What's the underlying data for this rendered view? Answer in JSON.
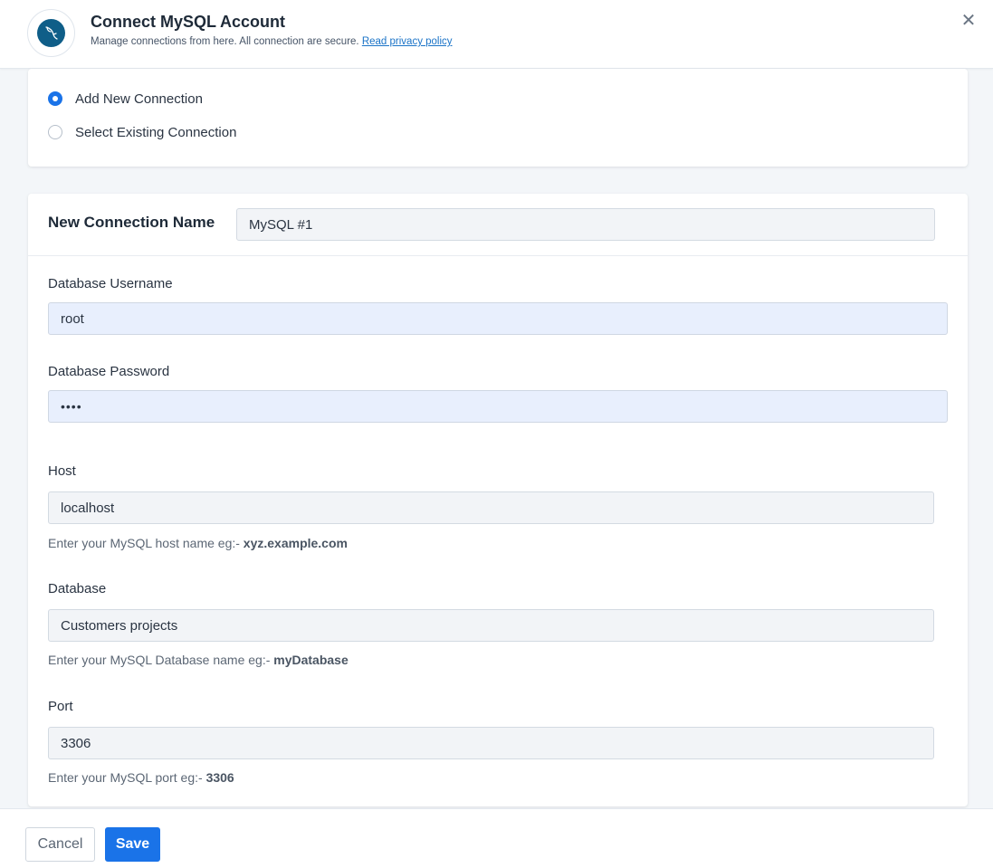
{
  "header": {
    "title": "Connect MySQL Account",
    "subtitle": "Manage connections from here. All connection are secure.",
    "privacy_link": "Read privacy policy",
    "close_symbol": "✕",
    "logo_icon": "mysql-dolphin-icon"
  },
  "connection_choice": {
    "options": [
      {
        "label": "Add New Connection",
        "selected": true
      },
      {
        "label": "Select Existing Connection",
        "selected": false
      }
    ]
  },
  "form": {
    "connection_name": {
      "label": "New Connection Name",
      "value": "MySQL #1"
    },
    "username": {
      "label": "Database Username",
      "value": "root"
    },
    "password": {
      "label": "Database Password",
      "value": "••••"
    },
    "host": {
      "label": "Host",
      "value": "localhost",
      "hint": "Enter your MySQL host name eg:- ",
      "hint_example": "xyz.example.com"
    },
    "database": {
      "label": "Database",
      "value": "Customers projects",
      "hint": "Enter your MySQL Database name eg:- ",
      "hint_example": "myDatabase"
    },
    "port": {
      "label": "Port",
      "value": "3306",
      "hint": "Enter your MySQL port eg:- ",
      "hint_example": "3306"
    }
  },
  "footer": {
    "cancel_label": "Cancel",
    "save_label": "Save"
  },
  "colors": {
    "accent": "#1a73e8",
    "logo_bg": "#0f5e88",
    "link": "#1a73c7"
  }
}
